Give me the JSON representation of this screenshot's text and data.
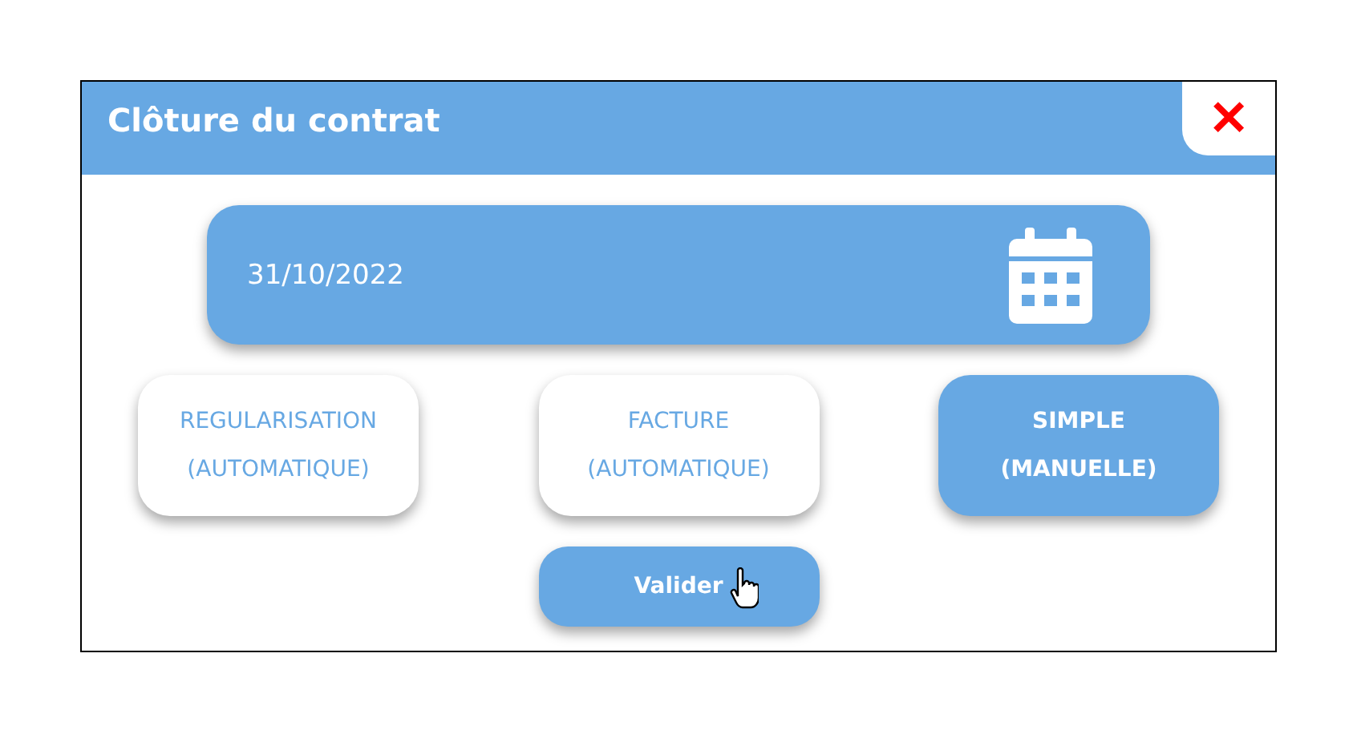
{
  "dialog": {
    "title": "Clôture du contrat",
    "close": "✕"
  },
  "date_field": {
    "value": "31/10/2022"
  },
  "options": [
    {
      "lines": [
        "REGULARISATION",
        "(AUTOMATIQUE)"
      ],
      "selected": false
    },
    {
      "lines": [
        "FACTURE",
        "(AUTOMATIQUE)"
      ],
      "selected": false
    },
    {
      "lines": [
        "SIMPLE",
        "(MANUELLE)"
      ],
      "selected": true
    }
  ],
  "submit": {
    "label": "Valider"
  }
}
